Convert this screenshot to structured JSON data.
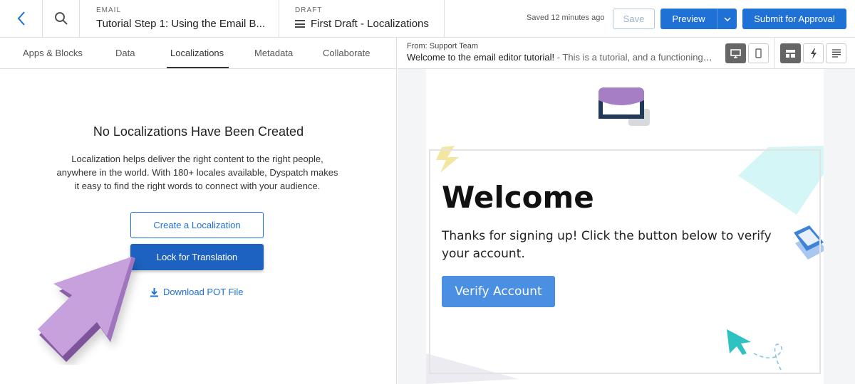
{
  "topbar": {
    "email_label": "EMAIL",
    "email_title": "Tutorial Step 1: Using the Email B...",
    "draft_label": "DRAFT",
    "draft_title": "First Draft - Localizations",
    "saved_text": "Saved 12 minutes ago",
    "save_label": "Save",
    "preview_label": "Preview",
    "submit_label": "Submit for Approval",
    "icons": {
      "back": "chevron-left-icon",
      "search": "search-icon",
      "menu": "hamburger-icon",
      "dropdown": "chevron-down-icon"
    }
  },
  "tabs": [
    {
      "label": "Apps & Blocks"
    },
    {
      "label": "Data"
    },
    {
      "label": "Localizations",
      "active": true
    },
    {
      "label": "Metadata"
    },
    {
      "label": "Collaborate"
    }
  ],
  "localizations": {
    "title": "No Localizations Have Been Created",
    "description": "Localization helps deliver the right content to the right people, anywhere in the world. With 180+ locales available, Dyspatch makes it easy to find the right words to connect with your audience.",
    "create_label": "Create a Localization",
    "lock_label": "Lock for Translation",
    "download_label": "Download POT File"
  },
  "preview": {
    "from": "From: Support Team",
    "subject": "Welcome to the email editor tutorial!",
    "preheader": " - This is a tutorial, and a functioning ...",
    "view_toggles": [
      "desktop-icon",
      "mobile-icon",
      "layout-icon",
      "lightning-icon",
      "text-lines-icon"
    ]
  },
  "email": {
    "heading": "Welcome",
    "body": "Thanks for signing up! Click the button below to verify your account.",
    "cta": "Verify Account"
  },
  "colors": {
    "primary": "#1f71d6",
    "lock_button": "#1d62c0",
    "verify_button": "#4a8fe2",
    "arrow_purple": "#c7a1dc",
    "mail_purple": "#a57fc4",
    "mail_navy": "#213a5c"
  }
}
